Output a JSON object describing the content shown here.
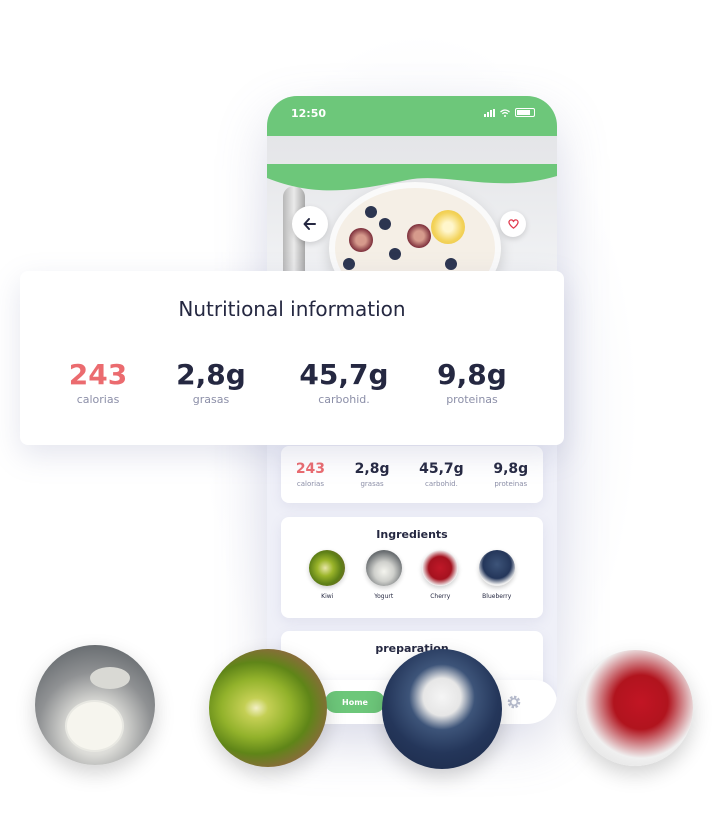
{
  "status_bar": {
    "time": "12:50"
  },
  "nutrition_big": {
    "title": "Nutritional information",
    "items": [
      {
        "value": "243",
        "label": "calorias"
      },
      {
        "value": "2,8g",
        "label": "grasas"
      },
      {
        "value": "45,7g",
        "label": "carbohid."
      },
      {
        "value": "9,8g",
        "label": "proteinas"
      }
    ]
  },
  "nutrition_small": {
    "items": [
      {
        "value": "243",
        "label": "calorias"
      },
      {
        "value": "2,8g",
        "label": "grasas"
      },
      {
        "value": "45,7g",
        "label": "carbohid."
      },
      {
        "value": "9,8g",
        "label": "proteinas"
      }
    ]
  },
  "ingredients": {
    "title": "Ingredients",
    "items": [
      {
        "label": "Kiwi"
      },
      {
        "label": "Yogurt"
      },
      {
        "label": "Cherry"
      },
      {
        "label": "Blueberry"
      }
    ]
  },
  "preparation": {
    "title": "preparation"
  },
  "bottom_nav": {
    "home_label": "Home"
  },
  "colors": {
    "accent_green": "#6dc77a",
    "calories_red": "#eb6b6f",
    "text_dark": "#252841",
    "text_muted": "#8c8fa8"
  },
  "icons": [
    "back-arrow-icon",
    "heart-icon",
    "gear-icon",
    "signal-icon",
    "wifi-icon",
    "battery-icon"
  ]
}
